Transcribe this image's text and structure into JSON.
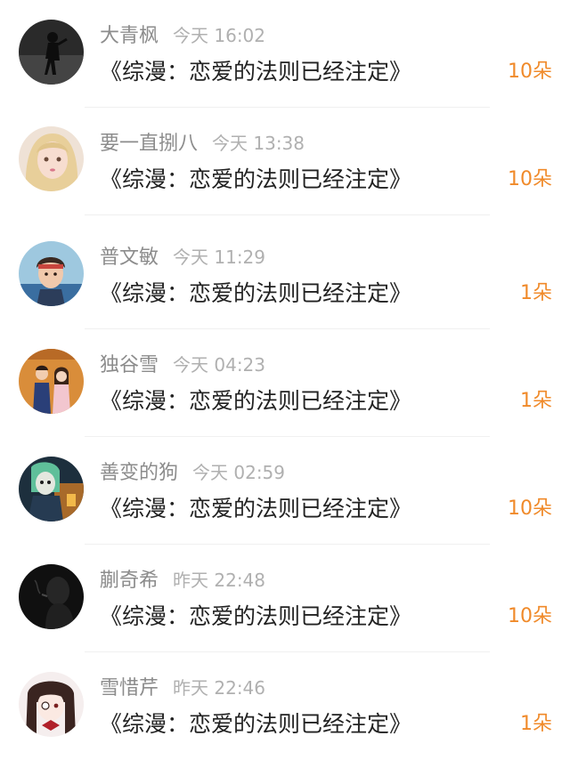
{
  "colors": {
    "name_text": "#8c8c8c",
    "time_text": "#b0b0b0",
    "title_text": "#222222",
    "count_text": "#f08a2a",
    "divider": "#f0f0f0"
  },
  "gifts": [
    {
      "name": "大青枫",
      "time": "今天 16:02",
      "title": "《综漫：恋爱的法则已经注定》",
      "count": "10朵",
      "avatar": "dark-silhouette-avatar"
    },
    {
      "name": "要一直捌八",
      "time": "今天 13:38",
      "title": "《综漫：恋爱的法则已经注定》",
      "count": "10朵",
      "avatar": "anime-girl-blonde-avatar"
    },
    {
      "name": "普文敏",
      "time": "今天 11:29",
      "title": "《综漫：恋爱的法则已经注定》",
      "count": "1朵",
      "avatar": "child-photo-avatar"
    },
    {
      "name": "独谷雪",
      "time": "今天 04:23",
      "title": "《综漫：恋爱的法则已经注定》",
      "count": "1朵",
      "avatar": "couple-photo-avatar"
    },
    {
      "name": "善变的狗",
      "time": "今天 02:59",
      "title": "《综漫：恋爱的法则已经注定》",
      "count": "10朵",
      "avatar": "anime-artwork-avatar"
    },
    {
      "name": "蒯奇希",
      "time": "昨天 22:48",
      "title": "《综漫：恋爱的法则已经注定》",
      "count": "10朵",
      "avatar": "dark-smoking-silhouette-avatar"
    },
    {
      "name": "雪惜芹",
      "time": "昨天 22:46",
      "title": "《综漫：恋爱的法则已经注定》",
      "count": "1朵",
      "avatar": "anime-girl-eyepatch-avatar"
    }
  ]
}
